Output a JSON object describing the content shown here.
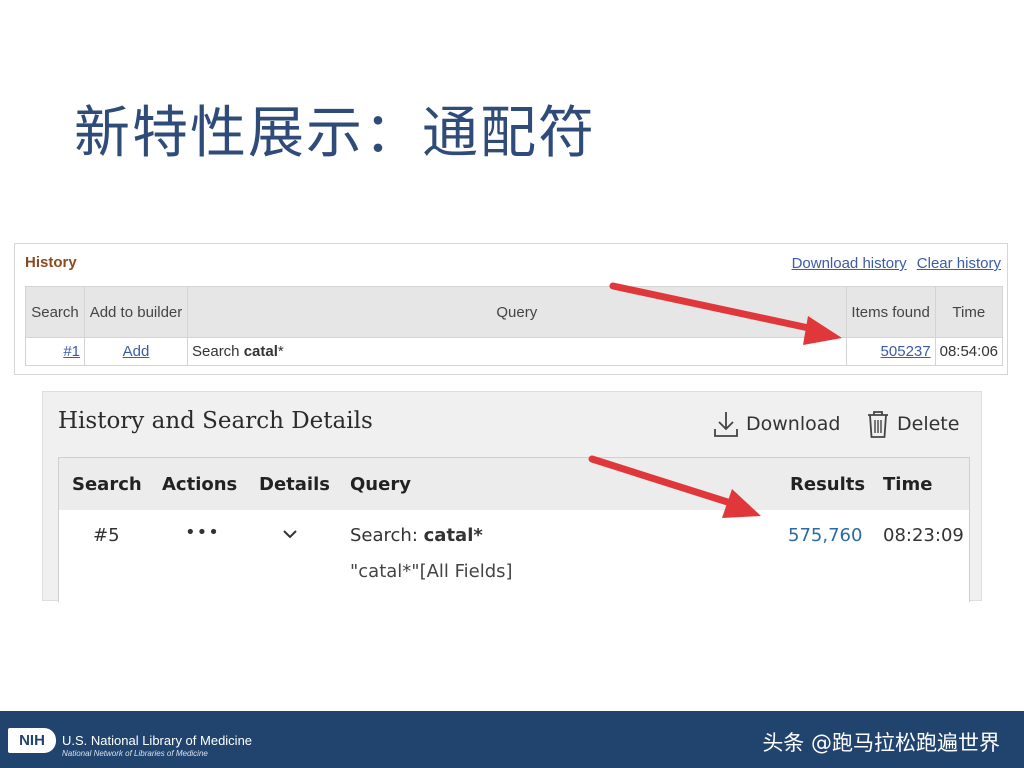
{
  "slide": {
    "title": "新特性展示：通配符"
  },
  "legacy_history": {
    "title": "History",
    "download_link": "Download history",
    "clear_link": "Clear history",
    "columns": {
      "search": "Search",
      "add_to_builder": "Add to builder",
      "query": "Query",
      "items_found": "Items found",
      "time": "Time"
    },
    "row": {
      "search": "#1",
      "add": "Add",
      "query_prefix": "Search",
      "query_term": "catal",
      "query_suffix": "*",
      "items_found": "505237",
      "time": "08:54:06"
    }
  },
  "new_history": {
    "title": "History and Search Details",
    "download_label": "Download",
    "delete_label": "Delete",
    "columns": {
      "search": "Search",
      "actions": "Actions",
      "details": "Details",
      "query": "Query",
      "results": "Results",
      "time": "Time"
    },
    "row": {
      "search": "#5",
      "actions": "•••",
      "details_icon": "chevron-down-icon",
      "query_prefix": "Search:",
      "query_term": "catal*",
      "query_detail": "\"catal*\"[All Fields]",
      "results": "575,760",
      "time": "08:23:09"
    }
  },
  "footer": {
    "logo": "NIH",
    "org_name": "U.S. National Library of Medicine",
    "org_sub": "National Network of Libraries of Medicine",
    "watermark": "头条 @跑马拉松跑遍世界"
  },
  "colors": {
    "title": "#2e4b7a",
    "link": "#3a5ba8",
    "results_link": "#2c6aa3",
    "footer_bg": "#21446f",
    "arrow": "#e0383a"
  }
}
